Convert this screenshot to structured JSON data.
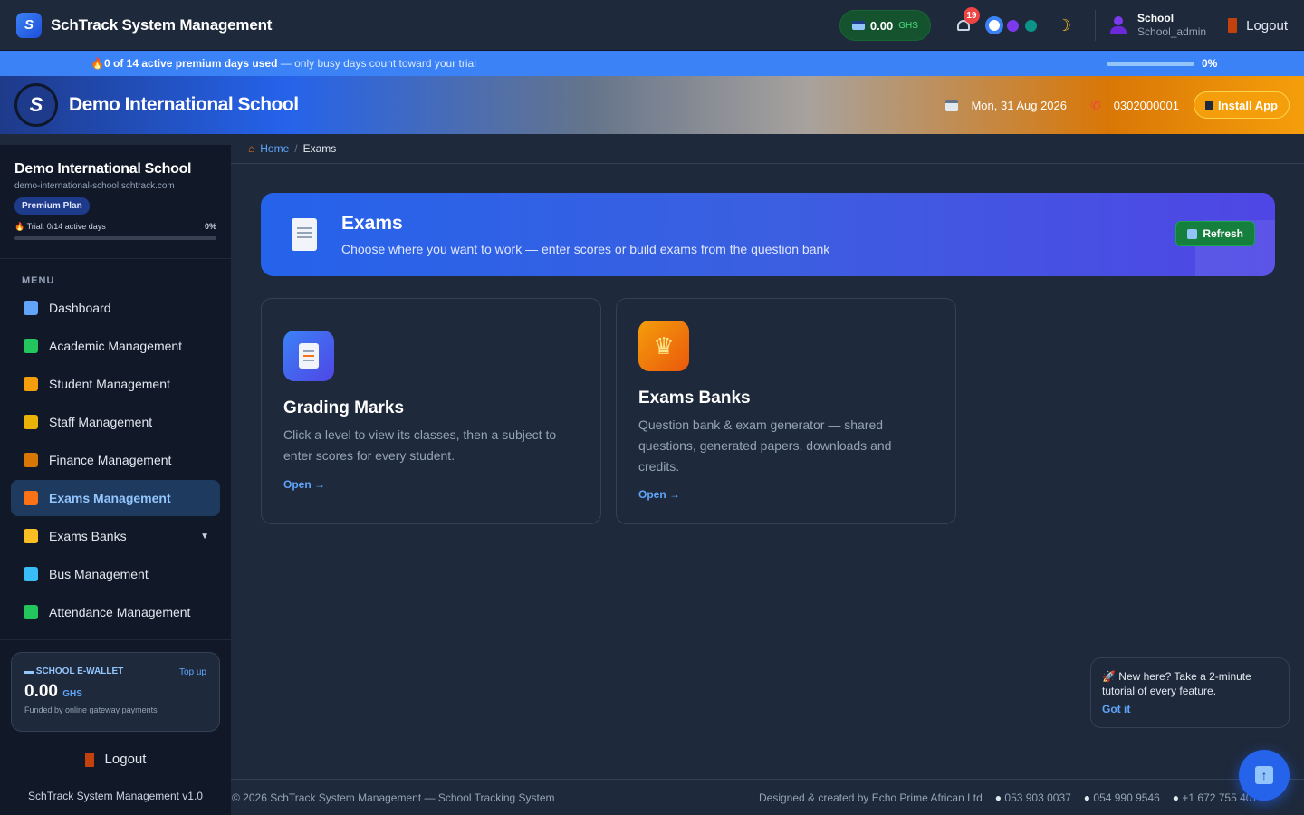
{
  "app": {
    "logo_glyph": "S",
    "title": "SchTrack System Management"
  },
  "topbar": {
    "wallet_amount": "0.00",
    "wallet_currency": "GHS",
    "notification_count": "19",
    "user_name": "School",
    "user_role": "School_admin",
    "logout_label": "Logout"
  },
  "trial_strip": {
    "flame": "🔥",
    "highlight": "0 of 14 active premium days used",
    "note": " — only busy days count toward your trial",
    "progress_percent": 0,
    "percent_label": "0%"
  },
  "banner": {
    "school_name": "Demo International School",
    "date": "Mon, 31 Aug 2026",
    "phone": "0302000001",
    "install_label": "Install App"
  },
  "sidebar": {
    "school_name": "Demo International School",
    "domain": "demo-international-school.schtrack.com",
    "plan": "Premium Plan",
    "trial_text": "Trial: 0/14 active days",
    "trial_percent": "0%",
    "menu_label": "MENU",
    "items": [
      {
        "label": "Dashboard",
        "icon": "bar-chart-icon",
        "color": "#60a5fa"
      },
      {
        "label": "Academic Management",
        "icon": "books-icon",
        "color": "#22c55e"
      },
      {
        "label": "Student Management",
        "icon": "student-icon",
        "color": "#f59e0b"
      },
      {
        "label": "Staff Management",
        "icon": "staff-icon",
        "color": "#eab308"
      },
      {
        "label": "Finance Management",
        "icon": "money-bag-icon",
        "color": "#d97706"
      },
      {
        "label": "Exams Management",
        "icon": "exam-doc-icon",
        "color": "#f97316"
      },
      {
        "label": "Exams Banks",
        "icon": "crown-icon",
        "color": "#fbbf24"
      },
      {
        "label": "Bus Management",
        "icon": "bus-icon",
        "color": "#38bdf8"
      },
      {
        "label": "Attendance Management",
        "icon": "check-icon",
        "color": "#22c55e"
      }
    ],
    "ewallet": {
      "label": "SCHOOL E-WALLET",
      "topup": "Top up",
      "amount": "0.00",
      "currency": "GHS",
      "note": "Funded by online gateway payments"
    },
    "logout_label": "Logout",
    "version": "SchTrack System Management v1.0"
  },
  "breadcrumb": {
    "home": "Home",
    "separator": "/",
    "current": "Exams"
  },
  "hero": {
    "title": "Exams",
    "subtitle": "Choose where you want to work — enter scores or build exams from the question bank",
    "refresh_label": "Refresh"
  },
  "cards": [
    {
      "title": "Grading Marks",
      "description": "Click a level to view its classes, then a subject to enter scores for every student.",
      "link": "Open →"
    },
    {
      "title": "Exams Banks",
      "description": "Question bank & exam generator — shared questions, generated papers, downloads and credits.",
      "link": "Open →"
    }
  ],
  "tour": {
    "message": "🚀 New here? Take a 2-minute tutorial of every feature.",
    "button": "Got it"
  },
  "footer": {
    "copyright": "© 2026 SchTrack System Management — School Tracking System",
    "credit": "Designed & created by Echo Prime African Ltd",
    "phone1": "053 903 0037",
    "phone2": "054 990 9546",
    "phone3": "+1 672 755 4077"
  }
}
